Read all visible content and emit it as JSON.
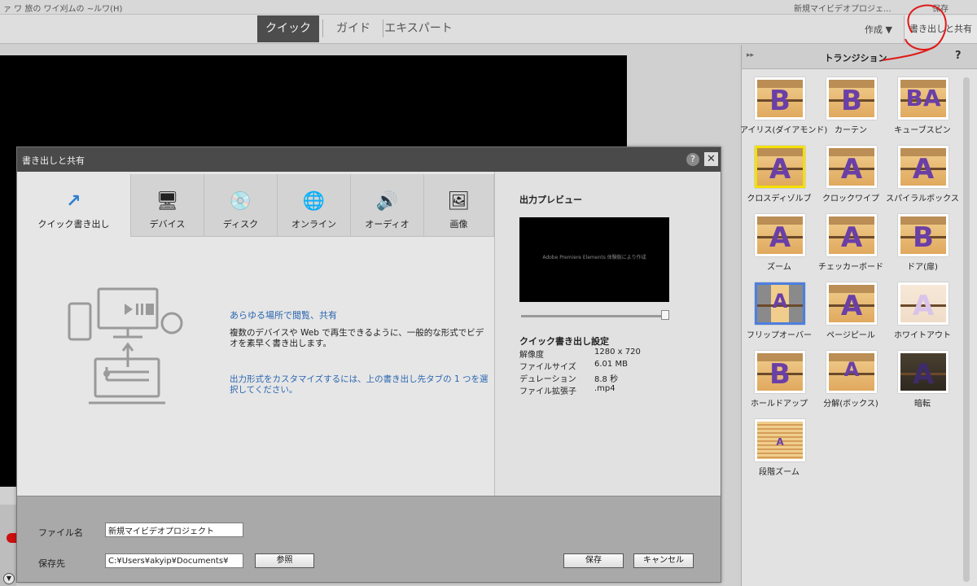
{
  "window": {
    "menu_text": "ァ  ワ  旅の  ワイ刈ムの  ~ルワ(H)",
    "project_text": "新規マイビデオプロジェ...",
    "window_menu": "保存"
  },
  "modes": {
    "quick": "クイック",
    "guided": "ガイド",
    "expert": "エキスパート",
    "create": "作成",
    "export_share": "書き出しと共有"
  },
  "right_panel": {
    "title": "トランジション",
    "help": "?",
    "transitions": [
      {
        "label": "アイリス(ダイアモンド)",
        "glyph": "B"
      },
      {
        "label": "カーテン",
        "glyph": "B"
      },
      {
        "label": "キューブスピン",
        "glyph": "BA"
      },
      {
        "label": "クロスディゾルブ",
        "glyph": "A"
      },
      {
        "label": "クロックワイプ",
        "glyph": "A"
      },
      {
        "label": "スパイラルボックス",
        "glyph": "A"
      },
      {
        "label": "ズーム",
        "glyph": "A"
      },
      {
        "label": "チェッカーボード",
        "glyph": "A"
      },
      {
        "label": "ドア(扉)",
        "glyph": "B"
      },
      {
        "label": "フリップオーバー",
        "glyph": "A"
      },
      {
        "label": "ページピール",
        "glyph": "A"
      },
      {
        "label": "ホワイトアウト",
        "glyph": "A"
      },
      {
        "label": "ホールドアップ",
        "glyph": "B"
      },
      {
        "label": "分解(ボックス)",
        "glyph": "A"
      },
      {
        "label": "暗転",
        "glyph": "A"
      },
      {
        "label": "段階ズーム",
        "glyph": "A"
      }
    ]
  },
  "dialog": {
    "title": "書き出しと共有",
    "help": "?",
    "close": "✕",
    "tabs": [
      {
        "label": "クイック書き出し",
        "icon": "↗"
      },
      {
        "label": "デバイス",
        "icon": "🖥"
      },
      {
        "label": "ディスク",
        "icon": "💿"
      },
      {
        "label": "オンライン",
        "icon": "🌐"
      },
      {
        "label": "オーディオ",
        "icon": "🔊"
      },
      {
        "label": "画像",
        "icon": "🖼"
      }
    ],
    "share_title": "あらゆる場所で閲覧、共有",
    "share_desc": "複数のデバイスや Web で再生できるように、一般的な形式でビデオを素早く書き出します。",
    "share_hint": "出力形式をカスタマイズするには、上の書き出し先タブの 1 つを選択してください。",
    "preview": {
      "title": "出力プレビュー",
      "overlay": "Adobe Premiere Elements 体験版により作成"
    },
    "settings": {
      "title": "クイック書き出し設定",
      "rows": [
        {
          "label": "解像度",
          "value": "1280 x 720"
        },
        {
          "label": "ファイルサイズ",
          "value": "6.01 MB"
        },
        {
          "label": "デュレーション",
          "value": "8.8 秒"
        },
        {
          "label": "ファイル拡張子",
          "value": ".mp4"
        }
      ]
    },
    "footer": {
      "filename_label": "ファイル名",
      "filename_value": "新規マイビデオプロジェクト",
      "location_label": "保存先",
      "location_value": "C:¥Users¥akyip¥Documents¥",
      "browse": "参照",
      "save": "保存",
      "cancel": "キャンセル"
    }
  },
  "colors": {
    "accent_link": "#2a66b0",
    "annotation": "#e01818",
    "selection_yellow": "#f3e100",
    "selection_blue": "#4e7fe0"
  }
}
